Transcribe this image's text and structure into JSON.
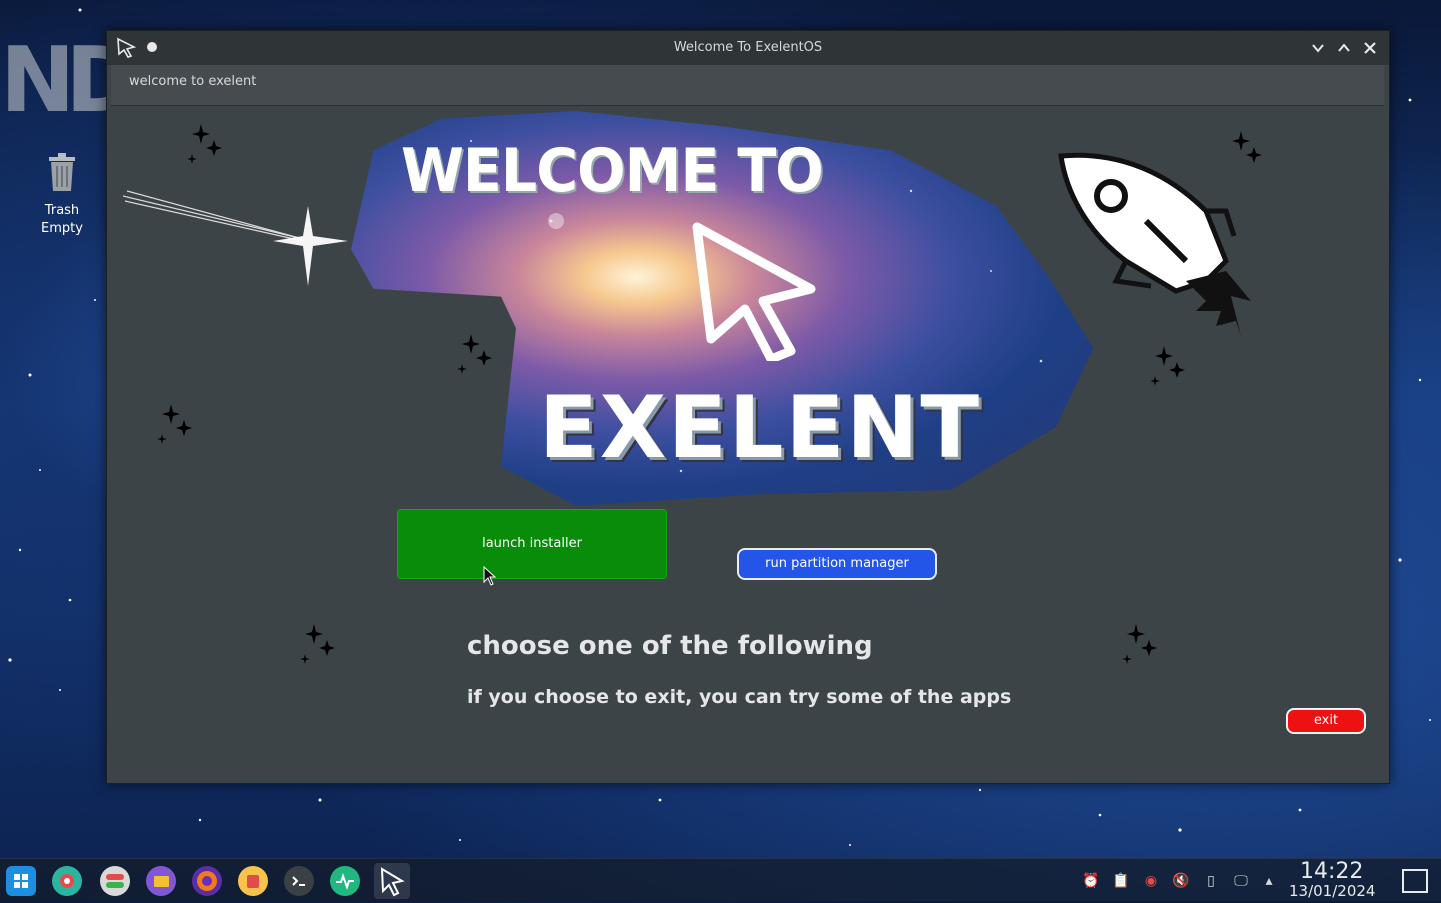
{
  "desktop": {
    "logo_text": "ND",
    "trash": {
      "name": "Trash",
      "status": "Empty"
    }
  },
  "window": {
    "title": "Welcome To ExelentOS",
    "menubar_label": "welcome to exelent",
    "controls": [
      "minimize",
      "maximize",
      "close"
    ]
  },
  "hero": {
    "welcome_text": "WELCOME TO",
    "brand_text": "EXELENT"
  },
  "buttons": {
    "launch_installer": "launch installer",
    "run_partition_manager": "run partition manager",
    "exit": "exit"
  },
  "text": {
    "heading": "choose one of the following",
    "subheading": "if you choose to exit, you can try some of the apps"
  },
  "colors": {
    "install_button": "#098c09",
    "partition_button": "#2255e8",
    "exit_button": "#ee1111",
    "window_bg": "#3d4447"
  },
  "taskbar": {
    "launchers": [
      "start-menu-icon",
      "settings-icon",
      "toggle-app-icon",
      "files-icon",
      "firefox-icon",
      "app-store-icon",
      "terminal-icon",
      "system-monitor-icon",
      "welcome-cursor-icon"
    ],
    "tray": [
      "alarm-icon",
      "clipboard-icon",
      "record-icon",
      "volume-muted-icon",
      "battery-icon",
      "network-icon",
      "expand-tray-icon"
    ],
    "time": "14:22",
    "date": "13/01/2024"
  }
}
